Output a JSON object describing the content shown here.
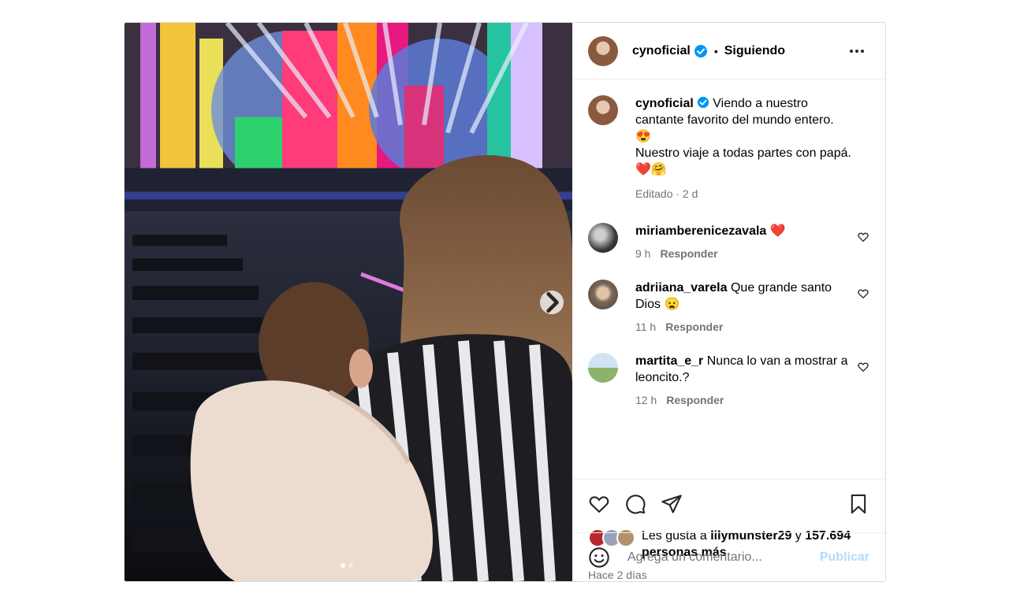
{
  "post": {
    "image_alt": "Mujer con camisa a rayas cargando a un bebé frente a un escenario de concierto con luces de colores",
    "carousel": {
      "total": 2,
      "current": 1
    }
  },
  "header": {
    "username": "cynoficial",
    "separator": "•",
    "follow_status": "Siguiendo"
  },
  "caption": {
    "username": "cynoficial",
    "line1": "Viendo a nuestro cantante favorito del mundo entero.",
    "emoji1": "😍",
    "line2": "Nuestro viaje a todas partes con papá.",
    "emoji2": "❤️🤗",
    "meta": "Editado · 2 d"
  },
  "comments": [
    {
      "username": "miriamberenicezavala",
      "text": "❤️",
      "time": "9 h",
      "reply": "Responder"
    },
    {
      "username": "adriiana_varela",
      "text": "Que grande santo Dios 😦",
      "time": "11 h",
      "reply": "Responder"
    },
    {
      "username": "martita_e_r",
      "text": "Nunca lo van a mostrar a leoncito.?",
      "time": "12 h",
      "reply": "Responder"
    }
  ],
  "likes": {
    "prefix": "Les gusta a",
    "user": "lilymunster29",
    "conj": "y",
    "count": "157.694",
    "suffix": "personas más"
  },
  "time_ago": "Hace 2 días",
  "add_comment": {
    "placeholder": "Agrega un comentario...",
    "publish": "Publicar"
  },
  "colors": {
    "verified": "#0095f6",
    "publish_disabled": "#b3dbff",
    "secondary_text": "#737373"
  }
}
